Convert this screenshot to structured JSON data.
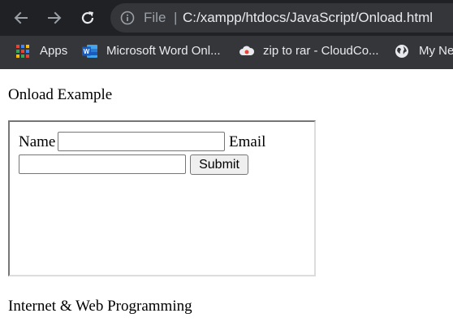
{
  "browser": {
    "omnibox": {
      "scheme_label": "File",
      "separator": "|",
      "url": "C:/xampp/htdocs/JavaScript/Onload.html"
    },
    "bookmarks": [
      {
        "label": "Apps",
        "icon": "apps-grid-icon"
      },
      {
        "label": "Microsoft Word Onl...",
        "icon": "word-icon"
      },
      {
        "label": "zip to rar - CloudCo...",
        "icon": "cloud-icon"
      },
      {
        "label": "My Ne",
        "icon": "globe-icon"
      }
    ],
    "colors": {
      "toolbar_bg": "#202124",
      "omnibox_bg": "#35363a",
      "bookmarks_bg": "#35363a",
      "text_light": "#e8eaed",
      "text_dim": "#9aa0a6"
    }
  },
  "page": {
    "heading": "Onload Example",
    "form": {
      "name_label": "Name",
      "name_value": "",
      "email_label": "Email",
      "email_value": "",
      "submit_label": "Submit"
    },
    "footer": "Internet & Web Programming"
  }
}
